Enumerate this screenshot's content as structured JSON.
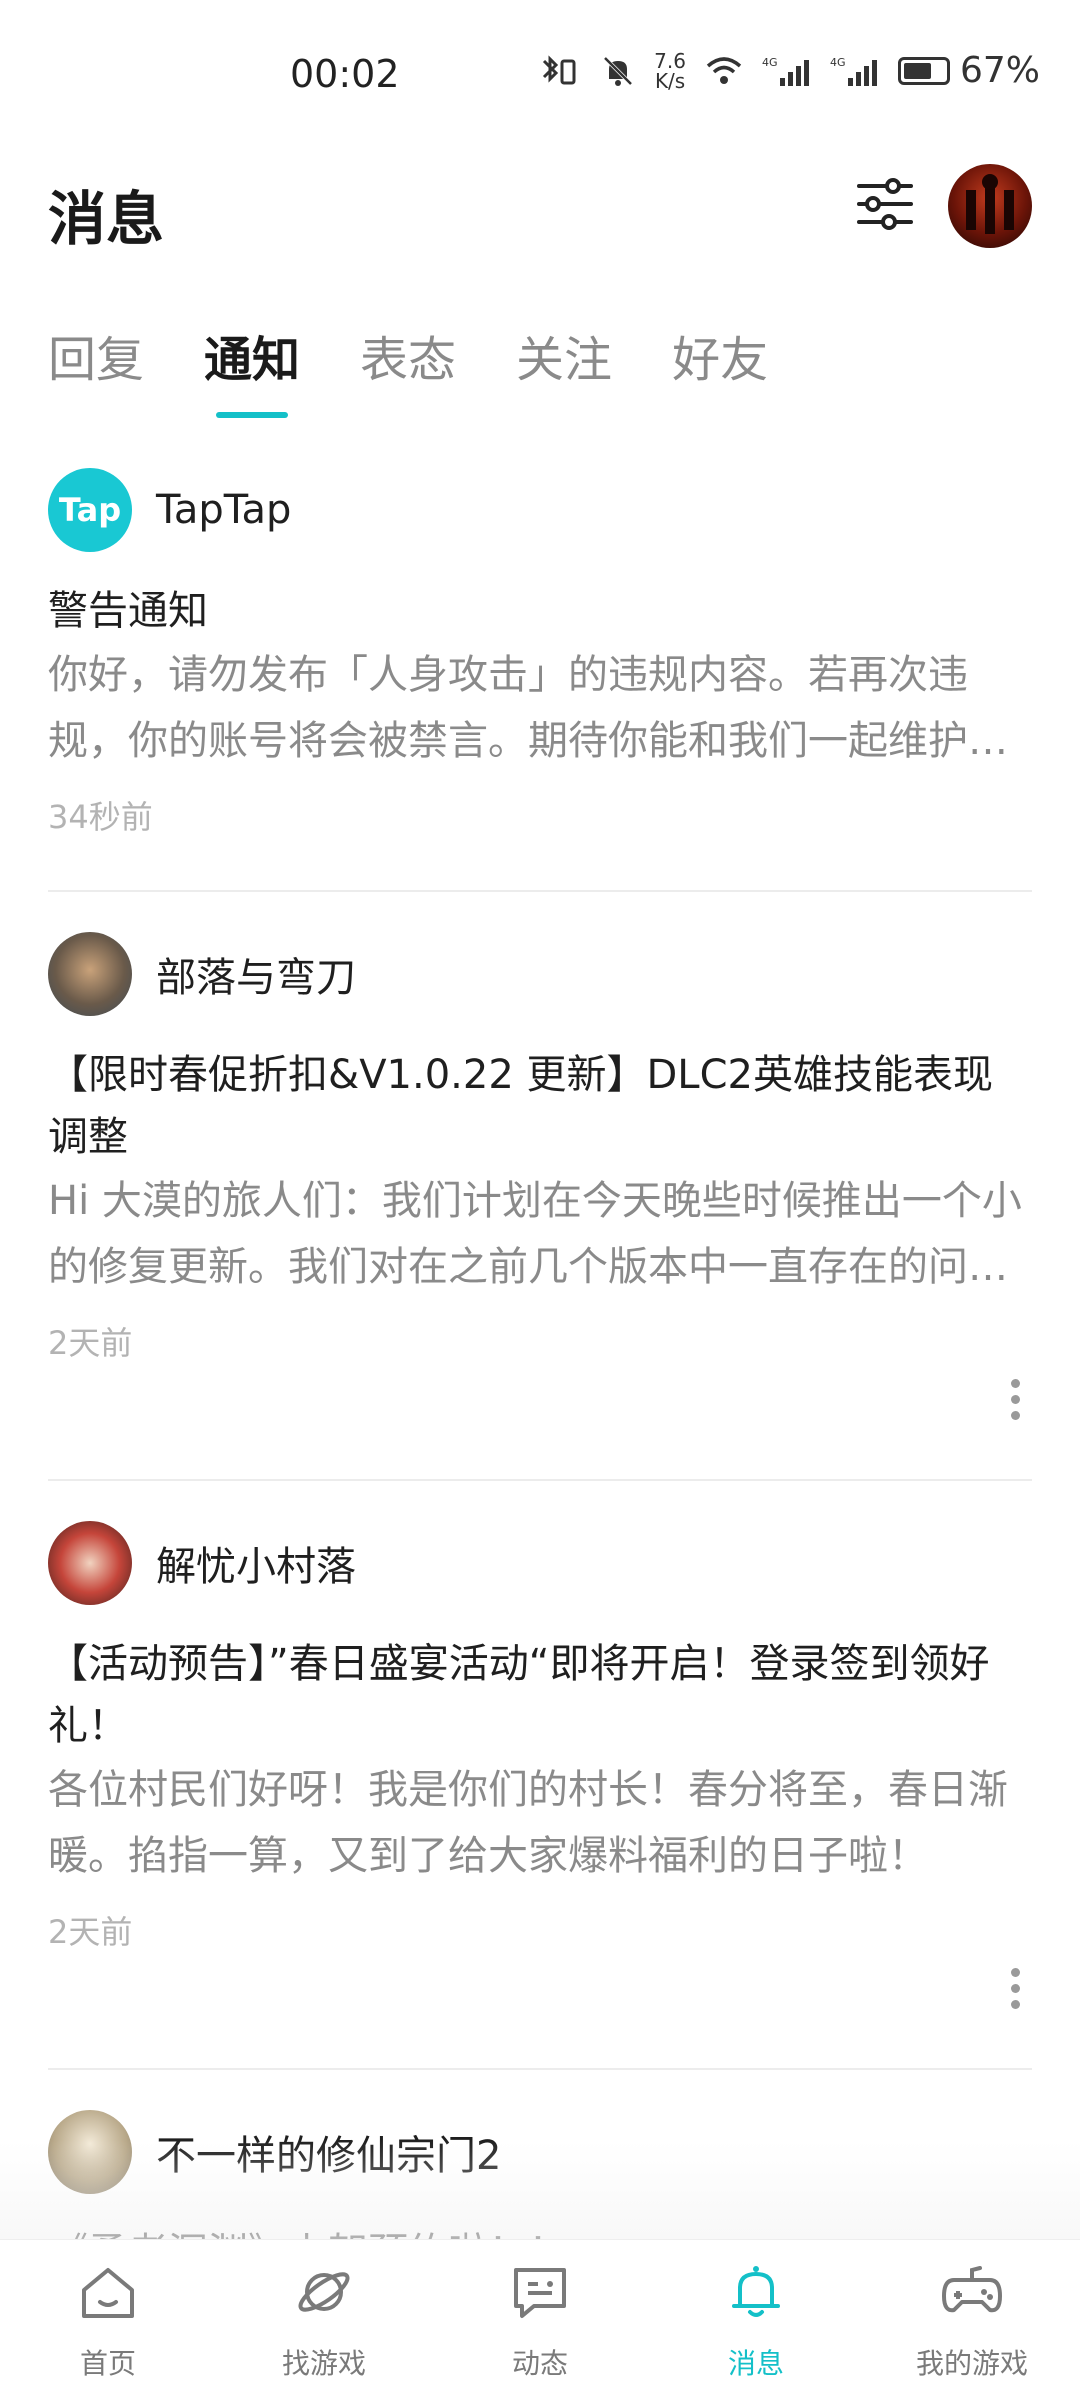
{
  "status_bar": {
    "time": "00:02",
    "net_speed_value": "7.6",
    "net_speed_unit": "K/s",
    "battery_percent": "67%",
    "battery_level": 0.67
  },
  "header": {
    "title": "消息"
  },
  "tabs": [
    {
      "label": "回复",
      "active": false
    },
    {
      "label": "通知",
      "active": true
    },
    {
      "label": "表态",
      "active": false
    },
    {
      "label": "关注",
      "active": false
    },
    {
      "label": "好友",
      "active": false
    }
  ],
  "messages": [
    {
      "sender": "TapTap",
      "avatar_text": "Tap",
      "title": "警告通知",
      "body": "你好，请勿发布「人身攻击」的违规内容。若再次违规，你的账号将会被禁言。期待你能和我们一起维护良好的社区环境。",
      "time": "34秒前"
    },
    {
      "sender": "部落与弯刀",
      "title": "【限时春促折扣&V1.0.22 更新】DLC2英雄技能表现调整",
      "body": "Hi 大漠的旅人们：我们计划在今天晚些时候推出一个小的修复更新。我们对在之前几个版本中一直存在的问题进行了修复。",
      "time": "2天前"
    },
    {
      "sender": "解忧小村落",
      "title": "【活动预告】”春日盛宴活动“即将开启！登录签到领好礼！",
      "body": "各位村民们好呀！我是你们的村长！春分将至，春日渐暖。掐指一算，又到了给大家爆料福利的日子啦！",
      "time": "2天前"
    },
    {
      "sender": "不一样的修仙宗门2",
      "title": "《勇者深渊》上架预约啦！！",
      "body": "",
      "time": ""
    }
  ],
  "bottom_nav": [
    {
      "label": "首页",
      "icon": "home-icon",
      "active": false
    },
    {
      "label": "找游戏",
      "icon": "planet-icon",
      "active": false
    },
    {
      "label": "动态",
      "icon": "chat-icon",
      "active": false
    },
    {
      "label": "消息",
      "icon": "bell-icon",
      "active": true
    },
    {
      "label": "我的游戏",
      "icon": "gamepad-icon",
      "active": false
    }
  ],
  "colors": {
    "accent": "#14c0c8",
    "muted_text": "#8a8a8a",
    "timestamp": "#b3b3b3"
  }
}
